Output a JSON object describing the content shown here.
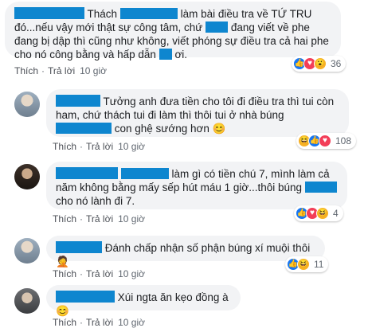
{
  "comments": [
    {
      "text_parts": [
        "Thách",
        "làm bài điều tra về TỨ TRU đó...nếu vậy mới thật sự công tâm, chứ",
        "đang viết về phe đang bị dập thì cũng như không, viết phóng sự điều tra cả hai phe cho nó công bằng và hấp dẫn",
        "ơi."
      ],
      "reactions": {
        "icons": [
          "like-icon",
          "love-icon",
          "wow-icon"
        ],
        "count": "36"
      },
      "actions": {
        "like": "Thích",
        "reply": "Trả lời",
        "time": "10 giờ"
      }
    },
    {
      "text_parts": [
        "Tưởng anh đưa tiền cho tôi đi điều tra thì tui còn ham, chứ thách tui đi làm thì thôi tui ở nhà búng",
        "con ghệ sướng hơn 😊"
      ],
      "reactions": {
        "icons": [
          "haha-icon",
          "like-icon",
          "love-icon"
        ],
        "count": "108"
      },
      "actions": {
        "like": "Thích",
        "reply": "Trả lời",
        "time": "10 giờ"
      }
    },
    {
      "text_parts": [
        "làm gì có tiền chú 7, mình làm cả năm không bằng mấy sếp hút máu 1 giờ...thôi búng",
        "cho nó lành đi 7."
      ],
      "reactions": {
        "icons": [
          "like-icon",
          "love-icon",
          "haha-icon"
        ],
        "count": "4"
      },
      "actions": {
        "like": "Thích",
        "reply": "Trả lời",
        "time": "10 giờ"
      }
    },
    {
      "text_parts": [
        "Đánh chấp nhận số phận búng xí muội thôi 🤦"
      ],
      "reactions": {
        "icons": [
          "like-icon",
          "haha-icon"
        ],
        "count": "11"
      },
      "actions": {
        "like": "Thích",
        "reply": "Trả lời",
        "time": "10 giờ"
      }
    },
    {
      "text_parts": [
        "Xúi ngta ăn kẹo đồng à 😊"
      ],
      "actions": {
        "like": "Thích",
        "reply": "Trả lời",
        "time": "10 giờ"
      }
    }
  ],
  "colors": {
    "redaction": "#0e86cf",
    "bubble": "#f2f3f5",
    "meta": "#606770"
  }
}
